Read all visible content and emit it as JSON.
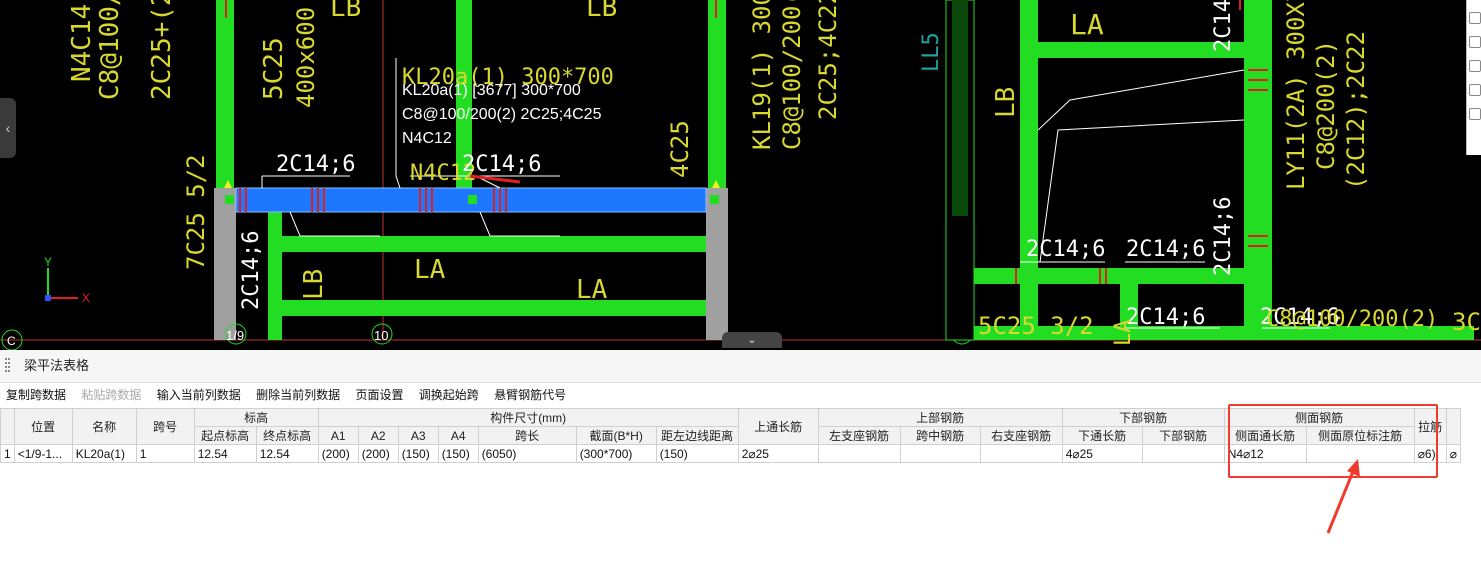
{
  "cad": {
    "labels": {
      "kl20a_name": "KL20a(1) 300*700",
      "kl20a_info_1": "KL20a(1) [3677] 300*700",
      "kl20a_info_2": "C8@100/200(2) 2C25;4C25",
      "kl20a_info_3": "N4C12",
      "left_2c14": "2C14;6",
      "mid_2c14": "2C14;6",
      "n4c12": "N4C12",
      "n4c14": "N4C14",
      "c8_left": "C8@100/15",
      "c25_left": "2C25+(2C1",
      "c5c25": "5C25",
      "size_400": "400x600",
      "lb_top": "LB",
      "lb_top2": "LB",
      "lb_mid": "LB",
      "la_mid1": "LA",
      "la_mid2": "LA",
      "c4c25": "4C25",
      "c7c25": "7C25 5/2",
      "left_vert_2c14": "2C14;6",
      "left_vert_2c14b": "2C14;6",
      "kl19": "KL19(1) 300",
      "kl19_c8": "C8@100/200(2",
      "kl19_2c25": "2C25;4C22",
      "ll5": "LL5",
      "la_right": "LA",
      "lb_right": "LB",
      "right_2c14_a": "2C14;6",
      "right_2c14_b": "2C14;6",
      "right_2c14_c": "2C14;6",
      "right_2c14_d": "2C14;6",
      "right_2c14_e": "2C14;6",
      "right_vert_2c14": "2C14",
      "ly11": "LY11(2A) 300X7",
      "ly11_c8": "C8@200(2)",
      "ly11_2c22": "(2C12);2C22",
      "c5c25_right": "5C25 3/2",
      "la_bottom_right": "LA",
      "c200_right": "C8@100/200(2)",
      "c3c": "3C",
      "axis_x": "X",
      "axis_y": "Y",
      "grid_19": "1/9",
      "grid_10": "10",
      "grid_11": "11",
      "grid_c": "C"
    }
  },
  "panel": {
    "title": "梁平法表格",
    "toolbar": [
      {
        "label": "复制跨数据",
        "enabled": true
      },
      {
        "label": "粘贴跨数据",
        "enabled": false
      },
      {
        "label": "输入当前列数据",
        "enabled": true
      },
      {
        "label": "删除当前列数据",
        "enabled": true
      },
      {
        "label": "页面设置",
        "enabled": true
      },
      {
        "label": "调换起始跨",
        "enabled": true
      },
      {
        "label": "悬臂钢筋代号",
        "enabled": true
      }
    ],
    "headers": {
      "position": "位置",
      "name": "名称",
      "span_no": "跨号",
      "elevation": "标高",
      "start_elev": "起点标高",
      "end_elev": "终点标高",
      "dims": "构件尺寸(mm)",
      "a1": "A1",
      "a2": "A2",
      "a3": "A3",
      "a4": "A4",
      "span_len": "跨长",
      "section": "截面(B*H)",
      "edge_dist": "距左边线距离",
      "top_cont": "上通长筋",
      "top_rebar": "上部钢筋",
      "left_support": "左支座钢筋",
      "mid_span": "跨中钢筋",
      "right_support": "右支座钢筋",
      "bottom_rebar": "下部钢筋",
      "bottom_cont": "下通长筋",
      "bottom_part": "下部钢筋",
      "side_rebar": "侧面钢筋",
      "side_cont": "侧面通长筋",
      "side_orig": "侧面原位标注筋",
      "tie": "拉筋"
    },
    "row": {
      "index": "1",
      "position": "<1/9-1...",
      "name": "KL20a(1)",
      "span_no": "1",
      "start_elev": "12.54",
      "end_elev": "12.54",
      "a1": "(200)",
      "a2": "(200)",
      "a3": "(150)",
      "a4": "(150)",
      "span_len": "(6050)",
      "section": "(300*700)",
      "edge_dist": "(150)",
      "top_cont": "2⌀25",
      "left_support": "",
      "mid_span": "",
      "right_support": "",
      "bottom_cont": "4⌀25",
      "bottom_part": "",
      "side_cont": "N4⌀12",
      "side_orig": "",
      "tie": "⌀6)",
      "extra": "⌀"
    }
  },
  "colors": {
    "cad_bg": "#000000",
    "beam_green": "#22dd22",
    "selected_beam": "#1e78ff",
    "highlight_red": "#f03a2c",
    "label_yellow": "#d8d830"
  }
}
